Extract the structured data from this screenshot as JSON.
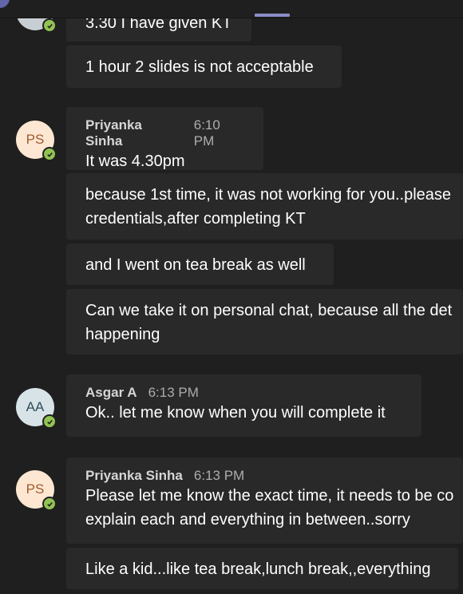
{
  "colors": {
    "background": "#1f1f1f",
    "bubble": "#292929",
    "presence_available": "#92c353",
    "accent": "#8b8cc7"
  },
  "messages": {
    "m0": "3.30 I have given KT",
    "m1": "1 hour 2 slides is not acceptable",
    "g1": {
      "avatar_initials": "PS",
      "author": "Priyanka Sinha",
      "time": "6:10 PM",
      "first": "It was 4.30pm",
      "b2_l1": "because 1st time, it was not working for you..please",
      "b2_l2": "credentials,after completing KT",
      "b3": "and I went on tea break as well",
      "b4_l1": "Can we take it on personal chat, because all the det",
      "b4_l2": "happening"
    },
    "g2": {
      "avatar_initials": "AA",
      "author": "Asgar A",
      "time": "6:13 PM",
      "first": "Ok.. let me know when you will complete it"
    },
    "g3": {
      "avatar_initials": "PS",
      "author": "Priyanka Sinha",
      "time": "6:13 PM",
      "first_l1": "Please let me know the exact time, it needs to be co",
      "first_l2": "explain each and everything in between..sorry",
      "b2": "Like a kid...like tea break,lunch break,,everything"
    }
  }
}
